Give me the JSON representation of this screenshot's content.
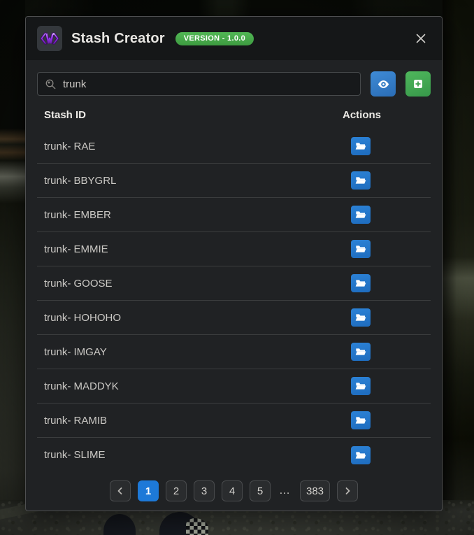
{
  "window": {
    "title": "Stash Creator",
    "version_badge": "VERSION - 1.0.0"
  },
  "icons": {
    "logo": "purple-gem-w-logo",
    "search": "magnifier-icon",
    "view": "eye-icon",
    "create": "plus-square-icon",
    "open": "folder-open-icon",
    "close": "x-icon",
    "prev": "chevron-left-icon",
    "next": "chevron-right-icon"
  },
  "search": {
    "value": "trunk"
  },
  "table": {
    "columns": [
      "Stash ID",
      "Actions"
    ],
    "rows": [
      "trunk- RAE",
      "trunk- BBYGRL",
      "trunk- EMBER",
      "trunk- EMMIE",
      "trunk- GOOSE",
      "trunk- HOHOHO",
      "trunk- IMGAY",
      "trunk- MADDYK",
      "trunk- RAMIB",
      "trunk- SLIME"
    ]
  },
  "pagination": {
    "pages": [
      "1",
      "2",
      "3",
      "4",
      "5"
    ],
    "ellipsis": "…",
    "last_page": "383",
    "active_page": "1"
  },
  "colors": {
    "accent_blue": "#2a6db6",
    "accent_green": "#37984a",
    "badge_green": "#43a047",
    "logo_purple": "#9333ea",
    "active_page_blue": "#1d79d8",
    "modal_bg": "#202224",
    "header_bg": "#151718"
  }
}
